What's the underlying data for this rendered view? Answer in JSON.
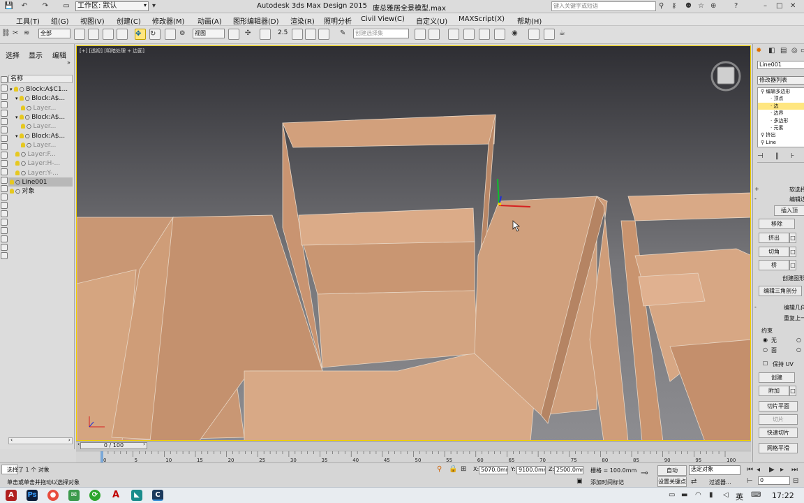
{
  "titlebar": {
    "workspace_label": "工作区: 默认",
    "app_title": "Autodesk 3ds Max Design 2015",
    "file_name": "废总雅居全景模型.max",
    "search_placeholder": "键入关键字或短语"
  },
  "menu": [
    "工具(T)",
    "组(G)",
    "视图(V)",
    "创建(C)",
    "修改器(M)",
    "动画(A)",
    "图形编辑器(D)",
    "渲染(R)",
    "照明分析",
    "Civil View(C)",
    "自定义(U)",
    "MAXScript(X)",
    "帮助(H)"
  ],
  "toolbar": {
    "selection_filter": "全部",
    "reference_coord": "视图",
    "snap_value": "2.5",
    "named_selection_placeholder": "创建选择集"
  },
  "scene_explorer": {
    "tabs": [
      "选择",
      "显示",
      "编辑"
    ],
    "column_header": "名称",
    "rows": [
      {
        "label": "Block:A$C1...",
        "level": 0,
        "state": "normal"
      },
      {
        "label": "Block:A$...",
        "level": 1,
        "state": "normal"
      },
      {
        "label": "Layer...",
        "level": 2,
        "state": "gray"
      },
      {
        "label": "Block:A$...",
        "level": 1,
        "state": "normal"
      },
      {
        "label": "Layer...",
        "level": 2,
        "state": "gray"
      },
      {
        "label": "Block:A$...",
        "level": 1,
        "state": "normal"
      },
      {
        "label": "Layer...",
        "level": 2,
        "state": "gray"
      },
      {
        "label": "Layer:F...",
        "level": 1,
        "state": "gray"
      },
      {
        "label": "Layer:H-...",
        "level": 1,
        "state": "gray"
      },
      {
        "label": "Layer:Y-...",
        "level": 1,
        "state": "gray"
      },
      {
        "label": "Line001",
        "level": 0,
        "state": "selected"
      },
      {
        "label": "对象",
        "level": 0,
        "state": "normal"
      }
    ]
  },
  "viewport": {
    "label": "[+] [透视] [明暗处理 + 边面]"
  },
  "command_panel": {
    "object_name": "Line001",
    "modifier_list_label": "修改器列表",
    "stack": [
      {
        "label": "编辑多边形",
        "level": 0
      },
      {
        "label": "顶点",
        "level": 1
      },
      {
        "label": "边",
        "level": 1,
        "selected": true
      },
      {
        "label": "边界",
        "level": 1
      },
      {
        "label": "多边形",
        "level": 1
      },
      {
        "label": "元素",
        "level": 1
      },
      {
        "label": "挤出",
        "level": 0
      },
      {
        "label": "Line",
        "level": 0
      }
    ],
    "rollout_select": "软选择",
    "rollout_edit_edges": "编辑边",
    "insert_vertex": "插入顶",
    "remove": "移除",
    "extrude": "挤出",
    "chamfer": "切角",
    "bridge": "桥",
    "create_shape": "创建图形",
    "edit_tri": "编辑三角剖分",
    "rollout_edit_geom": "编辑几何",
    "repeat_last": "重复上一",
    "constraints_label": "约束",
    "constraint_none": "无",
    "constraint_face": "面",
    "preserve_uv": "保持 UV",
    "create": "创建",
    "attach": "附加",
    "slice_plane": "切片平面",
    "slice": "切片",
    "quick_slice": "快速切片",
    "mesh_smooth": "网格平滑"
  },
  "timeline": {
    "frame_label": "0 / 100",
    "ticks": [
      "0",
      "5",
      "10",
      "15",
      "20",
      "25",
      "30",
      "35",
      "40",
      "45",
      "50",
      "55",
      "60",
      "65",
      "70",
      "75",
      "80",
      "85",
      "90",
      "95",
      "100"
    ]
  },
  "status": {
    "selection_msg": "选择了 1 个 对象",
    "prompt_msg": "单击或单击并拖动以选择对象",
    "x_label": "X:",
    "x_value": "5070.0mm",
    "y_label": "Y:",
    "y_value": "9100.0mm",
    "z_label": "Z:",
    "z_value": "2500.0mm",
    "grid_label": "栅格 = 100.0mm",
    "auto_key": "自动",
    "selected_obj": "选定对象",
    "set_key": "设置关键点",
    "filters": "过滤器...",
    "add_time_tag": "添加时间标记",
    "frame_input": "0"
  },
  "taskbar": {
    "ime_lang": "英",
    "time": "17:22"
  },
  "colors": {
    "wall": "#d9a884",
    "wall_dark": "#c08e6c",
    "wall_light": "#e3b896",
    "bg_top": "#2e2e33",
    "bg_bottom": "#8d8d91",
    "selected_row": "#b8b8b8",
    "viewport_border": "#f0d000"
  }
}
